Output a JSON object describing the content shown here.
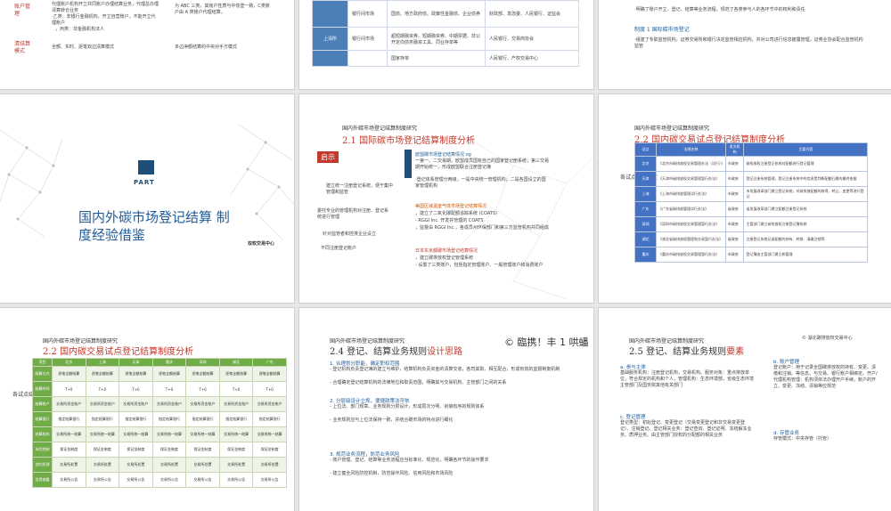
{
  "slide1": {
    "label1": "账户管理",
    "label2": "清结算模式",
    "text1": "代理账户机构开立共同账户办理结算业务，代理总办理清算转仓业务",
    "text2": "·乙类：非银行金融机构，开立自营账户，不能开立代理账户",
    "text3": "，丙类：非金融机构法人",
    "text4": "为 ABC 三类，其账户性质与中债登一致，C类账户由 A 类账户代理结算。",
    "text5": "全额、实时、逐笔双边清算模式",
    "text6": "多边净额结算的中央对手方模式"
  },
  "slide2": {
    "rows": [
      {
        "a": "",
        "b": "银行间市场",
        "c": "国债、地方政府债、政策性金融债、企业债券",
        "d": "财政部、发改委、人民银行、证监会"
      },
      {
        "a": "上清所",
        "b": "银行间市场",
        "c": "超短期融资券、短期融资券、中期票据、非公开定向债务融资工具、同业存单等",
        "d": "人民银行、交易商协会"
      },
      {
        "a": "",
        "b": "",
        "c": "国家存单",
        "d": "人民银行、产权交易中心"
      }
    ]
  },
  "slide3": {
    "line1": "·明确了账户开立、登记、结算等业务流程，规范了各类参与人的各环节中的权利和责任",
    "heading": "制度 1 国际碳市场登记",
    "line2": "·组建了专职监管机构，证券交易所和银行决定监管相应机构，并对公司进行信息披露管理，证券业协会配合监管机构监管"
  },
  "slide4": {
    "logo_text": "PART",
    "title": "国内外碳市场登记结算 制度经验借鉴",
    "corner_text": "双权交易中心"
  },
  "slide5": {
    "header": "国内外碳市场登记结算制度研究",
    "title_num": "2.1",
    "title": "国际碳市场登记结算制度分析",
    "tag": "启示",
    "eu_head": "欧盟碳市场登记结算情况 og",
    "eu_1": "一第一、二交易期，欧盟成员国有自己的国家登记册系统；第三交易期开始统一，形成欧盟联合注册登记簿",
    "eu_2": "·登记体系管理分两级，一是中央统一管理机构；二是各国设立的国家管理机构",
    "left_1": "建立统一注册登记系统，便于集中管理和监管",
    "left_2": "委托专业的管理机构对注册、登记系统进行管理",
    "left_3": "针对监管者和控排企业设立",
    "left_4": "不同注册登记账户",
    "us_head": "美国区域温室气体市场登记结算情况",
    "us_1": "，建立了二氧化碳配额追踪系统 (COATS)",
    "us_2": "- RGGI Inc. 开发并管理的 COATS",
    "us_3": "，监督由 RGGI Inc.，各成员州环保部门和第三方监管机构共同组成",
    "jp_head": "日本东京都碳市场登记结算情况",
    "jp_1": "，建立碳排放权登记管理系统",
    "jp_2": "- 设置了三类账户，包括指定管理账户、一般管理账户和消费账户"
  },
  "slide6": {
    "header": "国内外碳市场登记结算制度研究",
    "title_num": "2.2",
    "title": "国内碳交易试点登记结算制度分析",
    "side_label": "各试点登记制度",
    "table_head": [
      "试点",
      "法规名称",
      "发文机构",
      "主要内容"
    ],
    "rows": [
      [
        "北京",
        "《北京市碳排放权交易管理办法（试行）》",
        "市政府",
        "碳排放权注册登记系统对配额进行登记管理"
      ],
      [
        "天津",
        "《天津市碳排放权交易管理暂行办法》",
        "市政府",
        "登记注册系统管理，登记注册系统中的信息是判断配额归属的最终依据"
      ],
      [
        "上海",
        "《上海市碳排放管理试行办法》",
        "市政府",
        "市发展改革部门建立登记系统，对碳排放配额的取得、转让、变更等进行登记"
      ],
      [
        "广东",
        "《广东省碳排放管理试行办法》",
        "省政府",
        "省发展改革部门建立配额注册登记系统"
      ],
      [
        "深圳",
        "《深圳市碳排放权交易管理暂行办法》",
        "市政府",
        "主管部门建立碳排放权注册登记簿系统"
      ],
      [
        "湖北",
        "《湖北省碳排放权管理和交易暂行办法》",
        "省政府",
        "注册登记系统记录配额的持有、转移、清缴注销等"
      ],
      [
        "重庆",
        "《重庆市碳排放权交易管理暂行办法》",
        "市政府",
        "登记簿由主管部门建立和管理"
      ]
    ]
  },
  "slide7": {
    "header": "国内外碳市场登记结算制度研究",
    "title_num": "2.2",
    "title": "国内碳交易试点登记结算制度分析",
    "side_label": "各试点结算机制",
    "table_head": [
      "项目",
      "北京",
      "上海",
      "天津",
      "重庆",
      "深圳",
      "湖北",
      "广东"
    ],
    "rows": [
      [
        "结算方式",
        "逐笔全额结算",
        "逐笔全额结算",
        "逐笔全额结算",
        "逐笔全额结算",
        "逐笔全额结算",
        "逐笔全额结算",
        "逐笔全额结算"
      ],
      [
        "结算时间",
        "T+0",
        "T+0",
        "T+0",
        "T+0",
        "T+0",
        "T+0",
        "T+0"
      ],
      [
        "结算账户",
        "交易所资金账户",
        "交易所资金账户",
        "交易所资金账户",
        "交易所资金账户",
        "交易所资金账户",
        "交易所资金账户",
        "交易所资金账户"
      ],
      [
        "结算银行",
        "指定结算银行",
        "指定结算银行",
        "指定结算银行",
        "指定结算银行",
        "指定结算银行",
        "指定结算银行",
        "指定结算银行"
      ],
      [
        "结算机构",
        "交易所统一结算",
        "交易所统一结算",
        "交易所统一结算",
        "交易所统一结算",
        "交易所统一结算",
        "交易所统一结算",
        "交易所统一结算"
      ],
      [
        "风险控制",
        "保证金制度",
        "保证金制度",
        "保证金制度",
        "保证金制度",
        "保证金制度",
        "保证金制度",
        "保证金制度"
      ],
      [
        "违约处理",
        "交易所处置",
        "交易所处置",
        "交易所处置",
        "交易所处置",
        "交易所处置",
        "交易所处置",
        "交易所处置"
      ],
      [
        "信息披露",
        "交易所公告",
        "交易所公告",
        "交易所公告",
        "交易所公告",
        "交易所公告",
        "交易所公告",
        "交易所公告"
      ]
    ]
  },
  "slide8": {
    "header": "国内外碳市场登记结算制度研究",
    "stamp": "© 臨携！丰 1 哄蟠",
    "title_num": "2.4",
    "title": "登记、结算业务规则",
    "title_hl": "设计思路",
    "h1": "1. 合理划分职能，确定职权范围",
    "p1": "- 登记机构负责登记簿的建立与维护，结算机构负责资金的清算交收，各司其职、相互配合，形成有效的监督制衡机制",
    "p1b": "- 合理确定登记结算机构的法律地位和职责范围，明确其与交易机构、主管部门之间的关系",
    "h2": "2. 分层级设计立规，便捷政策法可依",
    "p2": "- 上位法、部门规章、业务规则分层设计，形成层次分明、衔接有序的规则体系",
    "p2b": "- 业务规则应与上位法保持一致，并结合碳市场的特点进行细化",
    "h3": "3. 规范业务流程，防范业务风险",
    "p3": "- 账户管理、登记、结算等业务流程应当标准化、规范化，明确各环节的操作要求",
    "p3b": "- 建立健全风险防控机制，防范操作风险、信用风险和市场风险"
  },
  "slide9": {
    "header": "国内外碳市场登记结算制度研究",
    "stamp": "© 湖北碳排放权交易中心",
    "title_num": "2.5",
    "title": "登记、结算业务规则",
    "title_hl": "要素",
    "a_head": "a. 参与主体",
    "a_text": "基础服务机构：注册登记机构，交易机构。服务对象：重点排放单位，符合规定的机构和个人。管理机构：生态环境部，省级生态环境主管部门及国务院其他有关部门",
    "c_head": "c. 登记管理",
    "c_text": "登记类型：初始登记、变更登记（交易变更登记和非交易变更登记）、注销登记。登记相关业务：登记查询、登记证明、冻结解冻业务、质押业务。由主管部门授权的分配额的相关业务",
    "b_head": "b. 账户管理",
    "b_text": "登记账户：用于记录全国碳排放权的持有、变更、清缴和注销。等信息。与交易、银行账户相绑定。开户/代理机构管理：机构须依法办理开户手续，账户的开立、变更、冻结、清销等应规范",
    "d_head": "d. 存管业务",
    "d_text": "存管模式：中央存管（托管）"
  }
}
